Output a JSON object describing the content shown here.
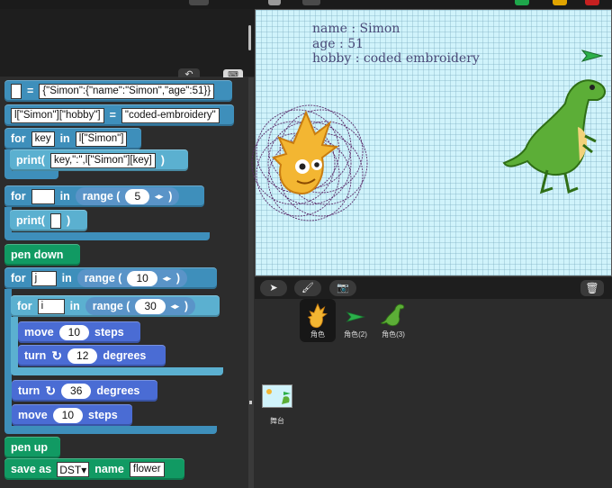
{
  "stage": {
    "lines": [
      "name : Simon",
      "age : 51",
      "hobby : coded embroidery"
    ]
  },
  "toolbar": {
    "undo_icon": "↶",
    "keyboard_icon": "⌨"
  },
  "scripts": {
    "b1": {
      "var": " ",
      "op": "=",
      "value": "{\"Simon\":{\"name\":\"Simon\",\"age\":51}}"
    },
    "b2": {
      "lhs": "l[\"Simon\"][\"hobby\"]",
      "op": "=",
      "value": "\"coded-embroidery\""
    },
    "b3": {
      "kw_for": "for",
      "var": "key",
      "kw_in": "in",
      "value": "l[\"Simon\"]"
    },
    "b4": {
      "kw": "print(",
      "arg": "key,\":\",l[\"Simon\"][key]",
      "close": ")"
    },
    "b5": {
      "kw_for": "for",
      "var": " ",
      "kw_in": "in",
      "range": "range (",
      "num": "5",
      "arrows": "◂▸",
      "close": ")"
    },
    "b6": {
      "kw": "print(",
      "arg": " ",
      "close": ")"
    },
    "b7": {
      "label": "pen down"
    },
    "b8": {
      "kw_for": "for",
      "var": "j",
      "kw_in": "in",
      "range": "range (",
      "num": "10",
      "arrows": "◂▸",
      "close": ")"
    },
    "b9": {
      "kw_for": "for",
      "var": "i",
      "kw_in": "in",
      "range": "range (",
      "num": "30",
      "arrows": "◂▸",
      "close": ")"
    },
    "b10": {
      "kw": "move",
      "num": "10",
      "unit": "steps"
    },
    "b11": {
      "kw": "turn",
      "icon": "↻",
      "num": "12",
      "unit": "degrees"
    },
    "b12": {
      "kw": "turn",
      "icon": "↻",
      "num": "36",
      "unit": "degrees"
    },
    "b13": {
      "kw": "move",
      "num": "10",
      "unit": "steps"
    },
    "b14": {
      "label": "pen up"
    },
    "b15": {
      "kw": "save as",
      "format": "DST",
      "dd": "▾",
      "kw2": "name",
      "value": "flower"
    }
  },
  "corral": {
    "tabs": {
      "sprites_icon": "➤",
      "paint_icon": "🖌",
      "camera_icon": "📷",
      "trash_icon": "🗑"
    },
    "sprites": [
      {
        "label": "角色",
        "icon": "gobo-sprite-icon"
      },
      {
        "label": "角色(2)",
        "icon": "green-arrow-sprite-icon"
      },
      {
        "label": "角色(3)",
        "icon": "dinosaur-sprite-icon"
      }
    ],
    "stage_label": "舞台"
  },
  "colors": {
    "control": "#3e8fbb",
    "sensing": "#1f9497",
    "motion": "#4a6cd4",
    "pen": "#119a63",
    "stage_bg": "#d0f3fb"
  }
}
